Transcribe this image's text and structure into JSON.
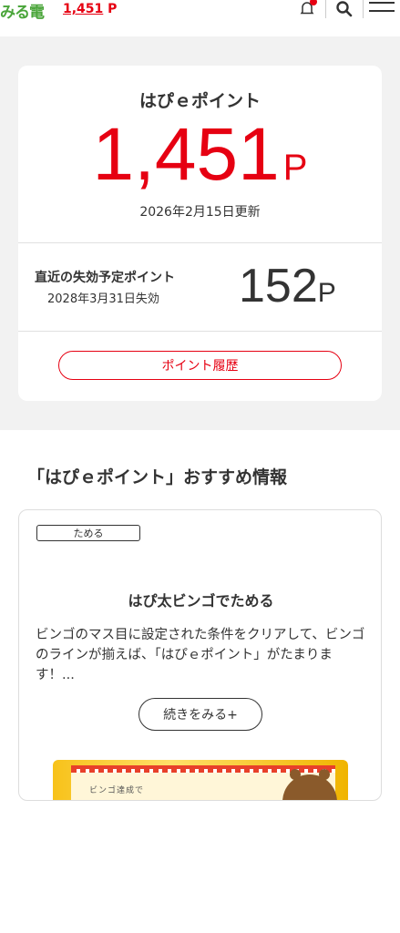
{
  "header": {
    "logo_text": "みる電",
    "points": "1,451",
    "points_unit": "P",
    "icons": [
      "bell-icon",
      "search-icon",
      "menu-icon"
    ]
  },
  "point_card": {
    "title": "はぴｅポイント",
    "points": "1,451",
    "unit": "P",
    "updated": "2026年2月15日更新",
    "expiring_label": "直近の失効予定ポイント",
    "expiring_date": "2028年3月31日失効",
    "expiring_points": "152",
    "expiring_unit": "P",
    "history_button": "ポイント履歴"
  },
  "recommend": {
    "section_title": "「はぴｅポイント」おすすめ情報",
    "tag": "ためる",
    "title": "はぴ太ビンゴでためる",
    "body": "ビンゴのマス目に設定された条件をクリアして、ビンゴのラインが揃えば、「はぴｅポイント」がたまります！...",
    "more_button": "続きをみる+",
    "banner_text": "ビンゴ達成で"
  },
  "colors": {
    "accent_red": "#e60012",
    "brand_green": "#4aa53a",
    "band_gray": "#f2f2f2"
  }
}
